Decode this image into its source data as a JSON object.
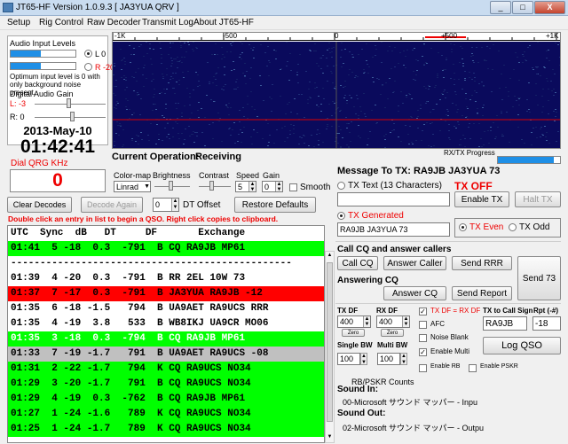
{
  "window": {
    "title": "JT65-HF Version 1.0.9.3  [ JA3YUA QRV ]",
    "min": "_",
    "max": "□",
    "close": "X"
  },
  "menu": [
    "Setup",
    "Rig Control",
    "Raw Decoder",
    "Transmit Log",
    "About JT65-HF"
  ],
  "audio": {
    "input_levels_label": "Audio Input Levels",
    "left_label": "L 0",
    "right_label": "R -20",
    "note": "Optimum input level is 0 with only background noise present.",
    "digital_gain_label": "Digital Audio Gain",
    "gain_l_label": "L: -3",
    "gain_r_label": "R: 0"
  },
  "clock": {
    "date": "2013-May-10",
    "time": "01:42:41"
  },
  "dial": {
    "label": "Dial QRG KHz",
    "value": "0"
  },
  "waterfall": {
    "scale_labels": [
      "-1K",
      "-500",
      "0",
      "+500",
      "+1K"
    ],
    "progress_label": "RX/TX Progress",
    "progress": 0.9
  },
  "status": {
    "label": "Current Operation:",
    "value": "Receiving"
  },
  "controls": {
    "colormap_label": "Color-map",
    "colormap_value": "Linrad",
    "brightness_label": "Brightness",
    "contrast_label": "Contrast",
    "speed_label": "Speed",
    "speed_value": "5",
    "gain_label": "Gain",
    "gain_value": "0",
    "smooth_label": "Smooth"
  },
  "decode_controls": {
    "clear_label": "Clear Decodes",
    "decode_again_label": "Decode Again",
    "dt_value": "0",
    "dt_label": "DT Offset",
    "restore_label": "Restore Defaults",
    "hint": "Double click an entry in list to begin a QSO.  Right click copies to clipboard."
  },
  "list": {
    "header": "UTC  Sync  dB   DT     DF       Exchange",
    "rows": [
      {
        "text": "01:41  5 -18  0.3  -791  B CQ RA9JB MP61",
        "bg": "#00ff00",
        "fg": "#000000"
      },
      {
        "text": "------------------------------------------------",
        "bg": "#ffffff",
        "fg": "#000000"
      },
      {
        "text": "01:39  4 -20  0.3  -791  B RR 2EL 10W 73",
        "bg": "#ffffff",
        "fg": "#000000"
      },
      {
        "text": "01:37  7 -17  0.3  -791  B JA3YUA RA9JB -12",
        "bg": "#ff0000",
        "fg": "#000000"
      },
      {
        "text": "01:35  6 -18 -1.5   794  B UA9AET RA9UCS RRR",
        "bg": "#ffffff",
        "fg": "#000000"
      },
      {
        "text": "01:35  4 -19  3.8   533  B WB8IKJ UA9CR MO06",
        "bg": "#ffffff",
        "fg": "#000000"
      },
      {
        "text": "01:35  3 -18  0.3  -794  B CQ RA9JB MP61",
        "bg": "#00ff00",
        "fg": "#ffffff"
      },
      {
        "text": "01:33  7 -19 -1.7   791  B UA9AET RA9UCS -08",
        "bg": "#c0c0c0",
        "fg": "#000000"
      },
      {
        "text": "01:31  2 -22 -1.7   794  K CQ RA9UCS NO34",
        "bg": "#00ff00",
        "fg": "#000000"
      },
      {
        "text": "01:29  3 -20 -1.7   791  B CQ RA9UCS NO34",
        "bg": "#00ff00",
        "fg": "#000000"
      },
      {
        "text": "01:29  4 -19  0.3  -762  B CQ RA9JB MP61",
        "bg": "#00ff00",
        "fg": "#000000"
      },
      {
        "text": "01:27  1 -24 -1.6   789  K CQ RA9UCS NO34",
        "bg": "#00ff00",
        "fg": "#000000"
      },
      {
        "text": "01:25  1 -24 -1.7   789  K CQ RA9UCS NO34",
        "bg": "#00ff00",
        "fg": "#000000"
      }
    ]
  },
  "tx": {
    "message_label": "Message To TX: RA9JB JA3YUA 73",
    "tx_text_label": "TX Text (13 Characters)",
    "tx_off_label": "TX OFF",
    "enable_tx_label": "Enable TX",
    "halt_tx_label": "Halt TX",
    "tx_generated_label": "TX Generated",
    "tx_generated_value": "RA9JB JA3YUA 73",
    "tx_even_label": "TX Even",
    "tx_odd_label": "TX Odd"
  },
  "qso": {
    "call_cq_section": "Call CQ and answer callers",
    "call_cq_label": "Call CQ",
    "answer_caller_label": "Answer Caller",
    "send_rrr_label": "Send RRR",
    "send_73_label": "Send 73",
    "answering_cq_section": "Answering CQ",
    "answer_cq_label": "Answer CQ",
    "send_report_label": "Send Report"
  },
  "df": {
    "tx_df_label": "TX DF",
    "tx_df_value": "400",
    "rx_df_label": "RX DF",
    "rx_df_value": "400",
    "zero_label": "Zero",
    "tx_eq_rx_label": "TX DF = RX DF",
    "afc_label": "AFC",
    "noise_blank_label": "Noise Blank",
    "enable_multi_label": "Enable Multi",
    "single_bw_label": "Single BW",
    "single_bw_value": "100",
    "multi_bw_label": "Multi BW",
    "multi_bw_value": "100",
    "enable_rb_label": "Enable RB",
    "enable_pskr_label": "Enable PSKR",
    "tx_to_call_label": "TX to Call Sign",
    "tx_to_call_value": "RA9JB",
    "rpt_label": "Rpt (-#)",
    "rpt_value": "-18",
    "log_qso_label": "Log QSO"
  },
  "sound": {
    "rb_counts": "RB/PSKR Counts",
    "sound_in_label": "Sound In:",
    "sound_in_value": "00-Microsoft サウンド マッパー - Inpu",
    "sound_out_label": "Sound Out:",
    "sound_out_value": "02-Microsoft サウンド マッパー - Outpu"
  },
  "colors": {
    "accent_red": "#ff0000",
    "waterfall_bg": "#0a0a5c",
    "progress_blue": "#1f8fe6"
  }
}
